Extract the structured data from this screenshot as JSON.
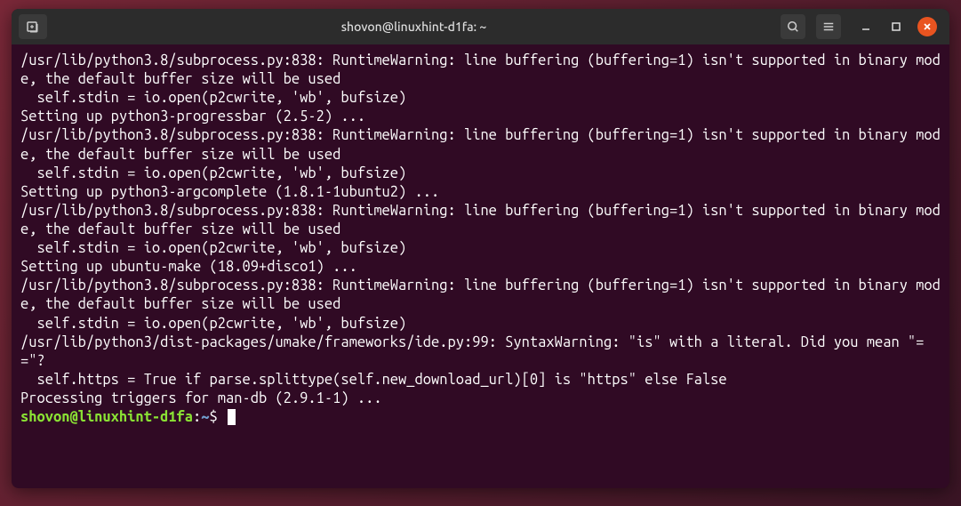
{
  "titlebar": {
    "title": "shovon@linuxhint-d1fa: ~"
  },
  "output": {
    "lines": [
      "/usr/lib/python3.8/subprocess.py:838: RuntimeWarning: line buffering (buffering=1) isn't supported in binary mode, the default buffer size will be used",
      "  self.stdin = io.open(p2cwrite, 'wb', bufsize)",
      "Setting up python3-progressbar (2.5-2) ...",
      "/usr/lib/python3.8/subprocess.py:838: RuntimeWarning: line buffering (buffering=1) isn't supported in binary mode, the default buffer size will be used",
      "  self.stdin = io.open(p2cwrite, 'wb', bufsize)",
      "Setting up python3-argcomplete (1.8.1-1ubuntu2) ...",
      "/usr/lib/python3.8/subprocess.py:838: RuntimeWarning: line buffering (buffering=1) isn't supported in binary mode, the default buffer size will be used",
      "  self.stdin = io.open(p2cwrite, 'wb', bufsize)",
      "Setting up ubuntu-make (18.09+disco1) ...",
      "/usr/lib/python3.8/subprocess.py:838: RuntimeWarning: line buffering (buffering=1) isn't supported in binary mode, the default buffer size will be used",
      "  self.stdin = io.open(p2cwrite, 'wb', bufsize)",
      "/usr/lib/python3/dist-packages/umake/frameworks/ide.py:99: SyntaxWarning: \"is\" with a literal. Did you mean \"==\"?",
      "  self.https = True if parse.splittype(self.new_download_url)[0] is \"https\" else False",
      "Processing triggers for man-db (2.9.1-1) ..."
    ]
  },
  "prompt": {
    "user_host": "shovon@linuxhint-d1fa",
    "separator": ":",
    "path": "~",
    "symbol": "$"
  }
}
